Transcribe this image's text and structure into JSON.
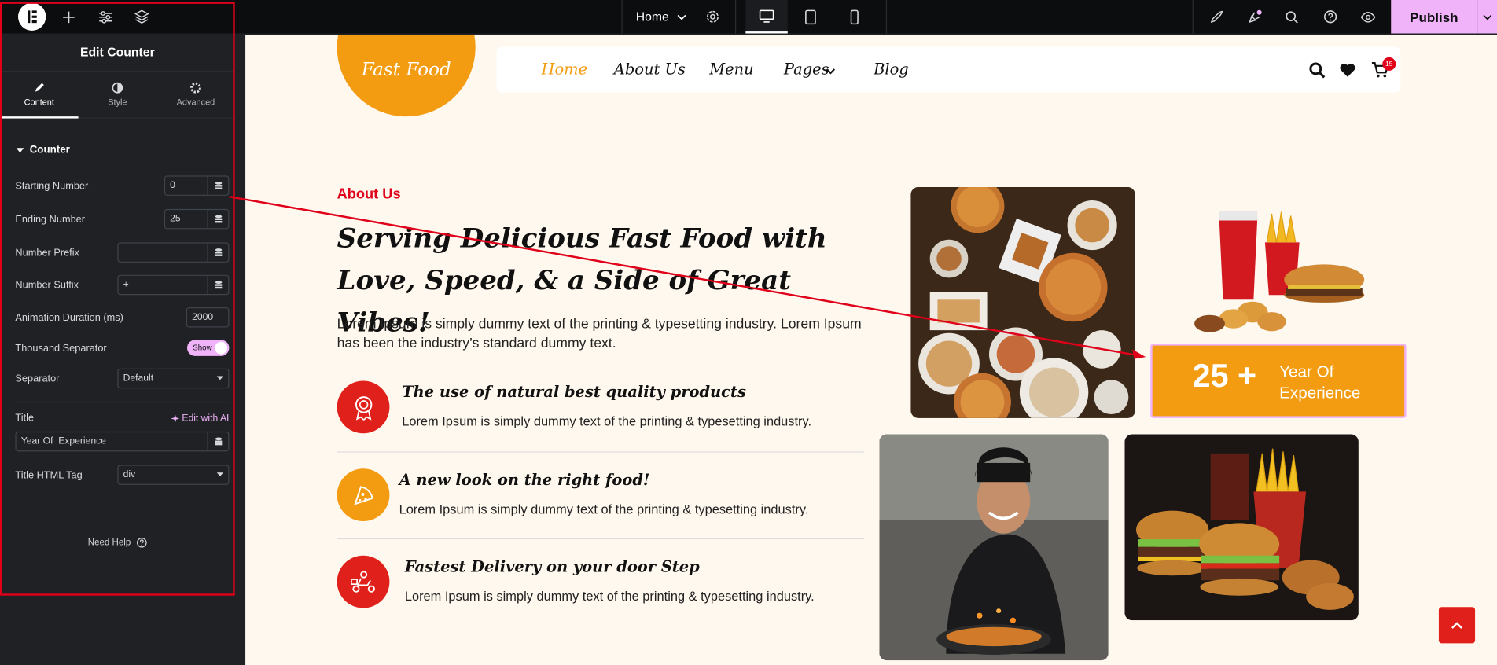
{
  "topbar": {
    "page_name": "Home",
    "publish_label": "Publish"
  },
  "panel": {
    "title": "Edit Counter",
    "tabs": [
      {
        "label": "Content",
        "icon": "pencil-icon"
      },
      {
        "label": "Style",
        "icon": "half-circle-icon"
      },
      {
        "label": "Advanced",
        "icon": "gear-icon"
      }
    ],
    "section": "Counter",
    "fields": {
      "starting_number": {
        "label": "Starting Number",
        "value": "0"
      },
      "ending_number": {
        "label": "Ending Number",
        "value": "25"
      },
      "number_prefix": {
        "label": "Number Prefix",
        "value": ""
      },
      "number_suffix": {
        "label": "Number Suffix",
        "value": "+"
      },
      "animation_duration": {
        "label": "Animation Duration (ms)",
        "value": "2000"
      },
      "thousand_separator": {
        "label": "Thousand Separator",
        "toggle": "Show"
      },
      "separator": {
        "label": "Separator",
        "value": "Default"
      },
      "title": {
        "label": "Title",
        "value": "Year Of  Experience",
        "ai_label": "Edit with AI"
      },
      "title_html_tag": {
        "label": "Title HTML Tag",
        "value": "div"
      }
    },
    "help": "Need Help"
  },
  "site": {
    "brand": "Fast Food",
    "nav": [
      "Home",
      "About Us",
      "Menu",
      "Pages",
      "Blog"
    ],
    "cart_count": "15",
    "about_tag": "About Us",
    "heading": "Serving Delicious Fast Food with Love, Speed, & a Side of Great Vibes!",
    "lead": "Lorem Ipsum is simply dummy text of the printing & typesetting industry. Lorem Ipsum has been the industry’s standard dummy text.",
    "features": [
      {
        "title": "The use of natural best quality products",
        "desc": "Lorem Ipsum is simply dummy text of the printing & typesetting industry."
      },
      {
        "title": "A new look on the right food!",
        "desc": "Lorem Ipsum is simply dummy text of the printing & typesetting industry."
      },
      {
        "title": "Fastest Delivery on your door Step",
        "desc": "Lorem Ipsum is simply dummy text of the printing & typesetting industry."
      }
    ],
    "counter": {
      "number": "25 +",
      "title": "Year Of Experience"
    }
  },
  "colors": {
    "accent": "#f39c12",
    "red": "#e0001a",
    "publish": "#f0b3f9"
  }
}
